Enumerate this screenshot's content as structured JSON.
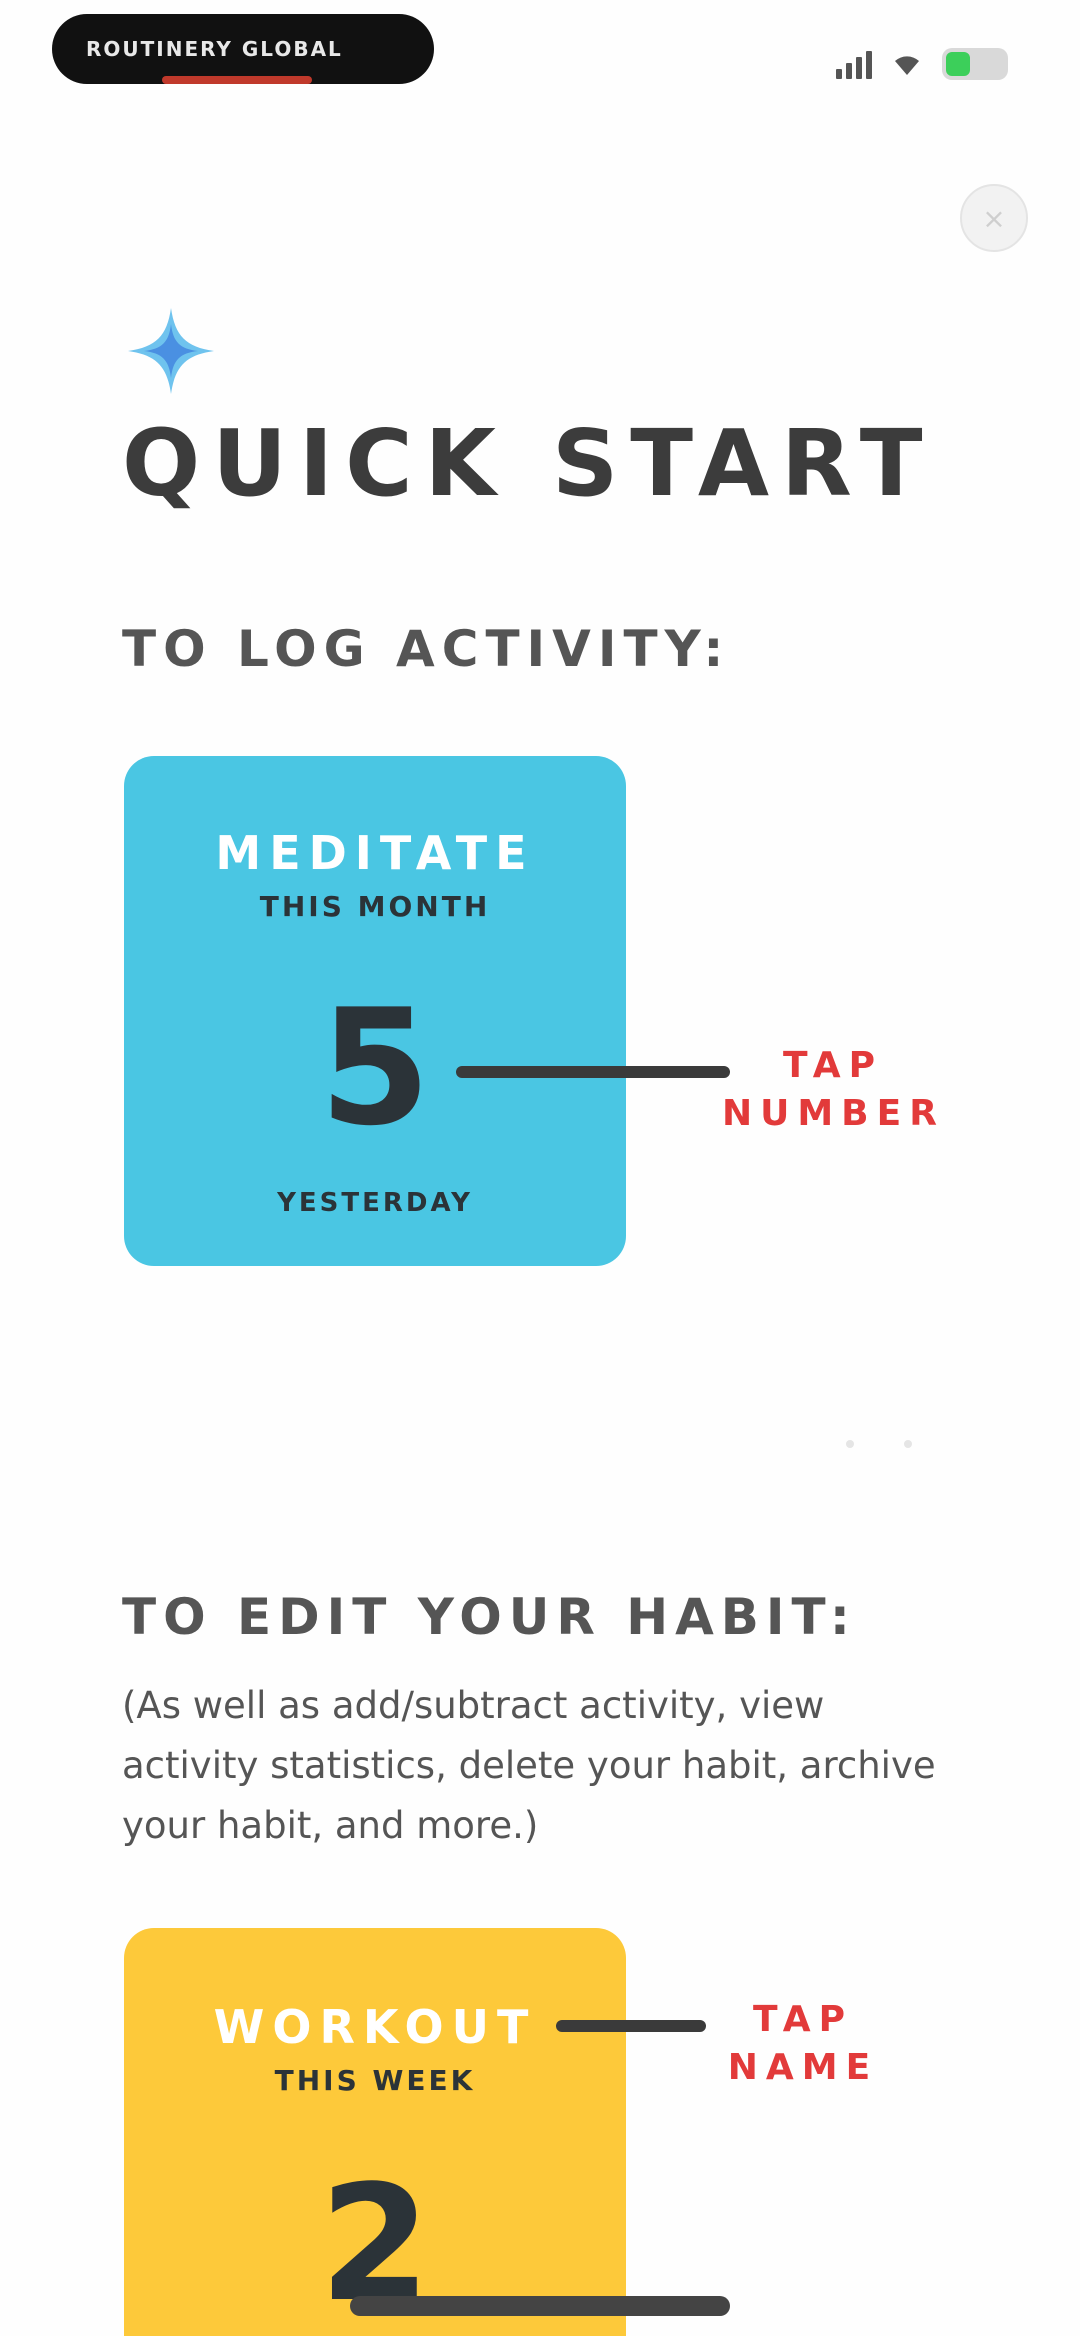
{
  "status_bar": {
    "pill_text": "ROUTINERY  GLOBAL",
    "icons": [
      "signal-icon",
      "wifi-icon",
      "battery-icon"
    ],
    "accent_red": "#c0392b",
    "battery_green": "#3ccf5a"
  },
  "close_button": {
    "icon": "close-icon",
    "label": "×"
  },
  "header": {
    "icon": "sparkle-icon",
    "title": "QUICK START"
  },
  "section_log": {
    "heading": "TO LOG ACTIVITY:",
    "card": {
      "name": "MEDITATE",
      "period": "THIS MONTH",
      "number": "5",
      "footer": "YESTERDAY",
      "color": "#4ac6e3"
    },
    "hint": {
      "line1": "TAP",
      "line2": "NUMBER"
    }
  },
  "section_edit": {
    "heading": "TO EDIT YOUR HABIT:",
    "description": "(As well as add/subtract activity, view activity statistics, delete your habit, archive your habit, and more.)",
    "card": {
      "name": "WORKOUT",
      "period": "THIS WEEK",
      "number": "2",
      "color": "#fdc93a"
    },
    "hint": {
      "line1": "TAP",
      "line2": "NAME"
    }
  },
  "colors": {
    "hint_red": "#e23a3a",
    "text_dark": "#3c3c3c"
  }
}
